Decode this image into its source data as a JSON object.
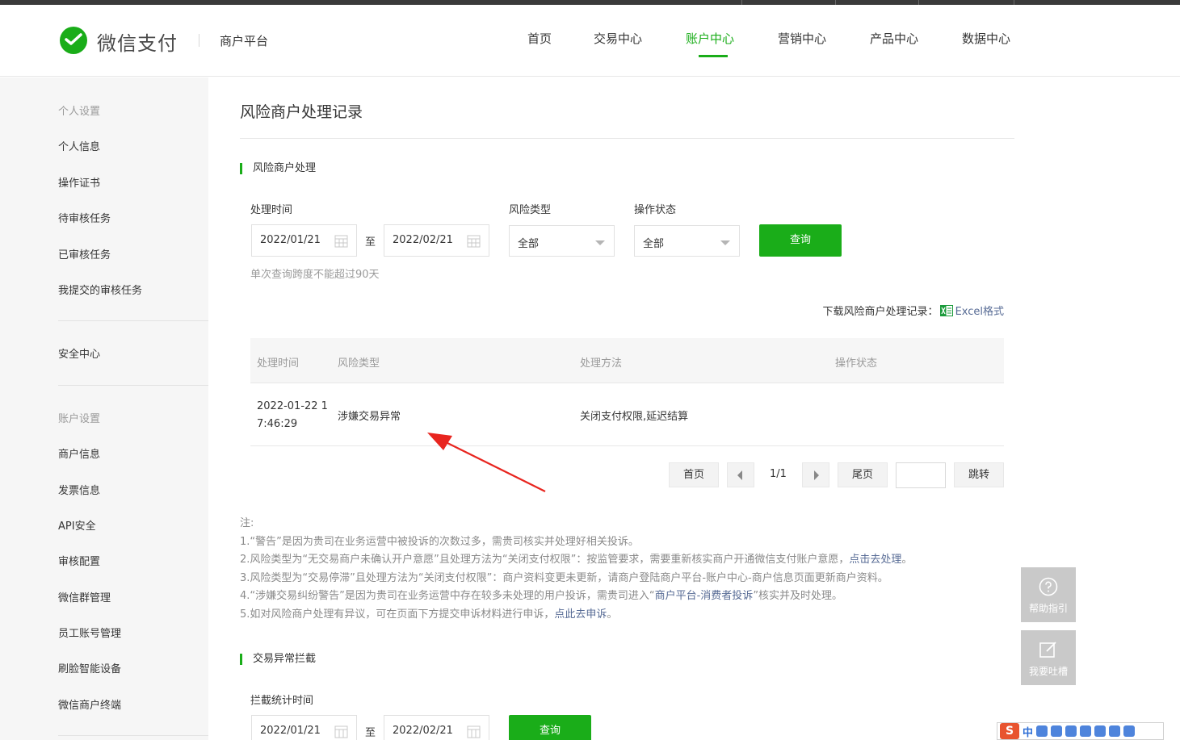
{
  "brand": {
    "logo_text": "微信支付",
    "platform": "商户平台",
    "accent_color": "#1aad19",
    "link_color": "#576b95"
  },
  "nav": {
    "items": [
      "首页",
      "交易中心",
      "账户中心",
      "营销中心",
      "产品中心",
      "数据中心"
    ],
    "active": "账户中心"
  },
  "sidebar": {
    "group_personal": "个人设置",
    "personal_info": "个人信息",
    "op_cert": "操作证书",
    "pending_review": "待审核任务",
    "reviewed": "已审核任务",
    "my_submitted": "我提交的审核任务",
    "security_center": "安全中心",
    "group_account": "账户设置",
    "merchant_info": "商户信息",
    "invoice_info": "发票信息",
    "api_security": "API安全",
    "review_config": "审核配置",
    "wechat_group": "微信群管理",
    "staff_account": "员工账号管理",
    "face_device": "刷脸智能设备",
    "merchant_terminal": "微信商户终端"
  },
  "page": {
    "title": "风险商户处理记录"
  },
  "risk_section": {
    "title": "风险商户处理",
    "time_label": "处理时间",
    "start_date": "2022/01/21",
    "to": "至",
    "end_date": "2022/02/21",
    "type_label": "风险类型",
    "type_value": "全部",
    "status_label": "操作状态",
    "status_value": "全部",
    "query_button": "查询",
    "hint": "单次查询跨度不能超过90天",
    "download_label": "下载风险商户处理记录：",
    "download_link": "Excel格式"
  },
  "table": {
    "headers": [
      "处理时间",
      "风险类型",
      "处理方法",
      "操作状态"
    ],
    "rows": [
      {
        "time": "2022-01-22 17:46:29",
        "type": "涉嫌交易异常",
        "method": "关闭支付权限,延迟结算",
        "status": ""
      }
    ]
  },
  "pager": {
    "first": "首页",
    "count": "1/1",
    "last": "尾页",
    "jump_value": "",
    "jump": "跳转"
  },
  "notes": {
    "heading": "注:",
    "line1": "1.“警告”是因为贵司在业务运营中被投诉的次数过多，需贵司核实并处理好相关投诉。",
    "line2_pre": "2.风险类型为“无交易商户未确认开户意愿”且处理方法为“关闭支付权限”：按监管要求，需要重新核实商户开通微信支付账户意愿，",
    "line2_link": "点击去处理",
    "line2_post": "。",
    "line3": "3.风险类型为“交易停滞”且处理方法为“关闭支付权限”：商户资料变更未更新，请商户登陆商户平台-账户中心-商户信息页面更新商户资料。",
    "line4_pre": "4.“涉嫌交易纠纷警告”是因为贵司在业务运营中存在较多未处理的用户投诉，需贵司进入“",
    "line4_link": "商户平台-消费者投诉",
    "line4_post": "”核实并及时处理。",
    "line5_pre": "5.如对风险商户处理有异议，可在页面下方提交申诉材料进行申诉，",
    "line5_link": "点此去申诉",
    "line5_post": "。"
  },
  "intercept_section": {
    "title": "交易异常拦截",
    "time_label": "拦截统计时间",
    "start_date": "2022/01/21",
    "to": "至",
    "end_date": "2022/02/21",
    "query_button": "查询"
  },
  "float": {
    "help": "帮助指引",
    "feedback": "我要吐槽"
  },
  "ime": {
    "lang": "中"
  }
}
